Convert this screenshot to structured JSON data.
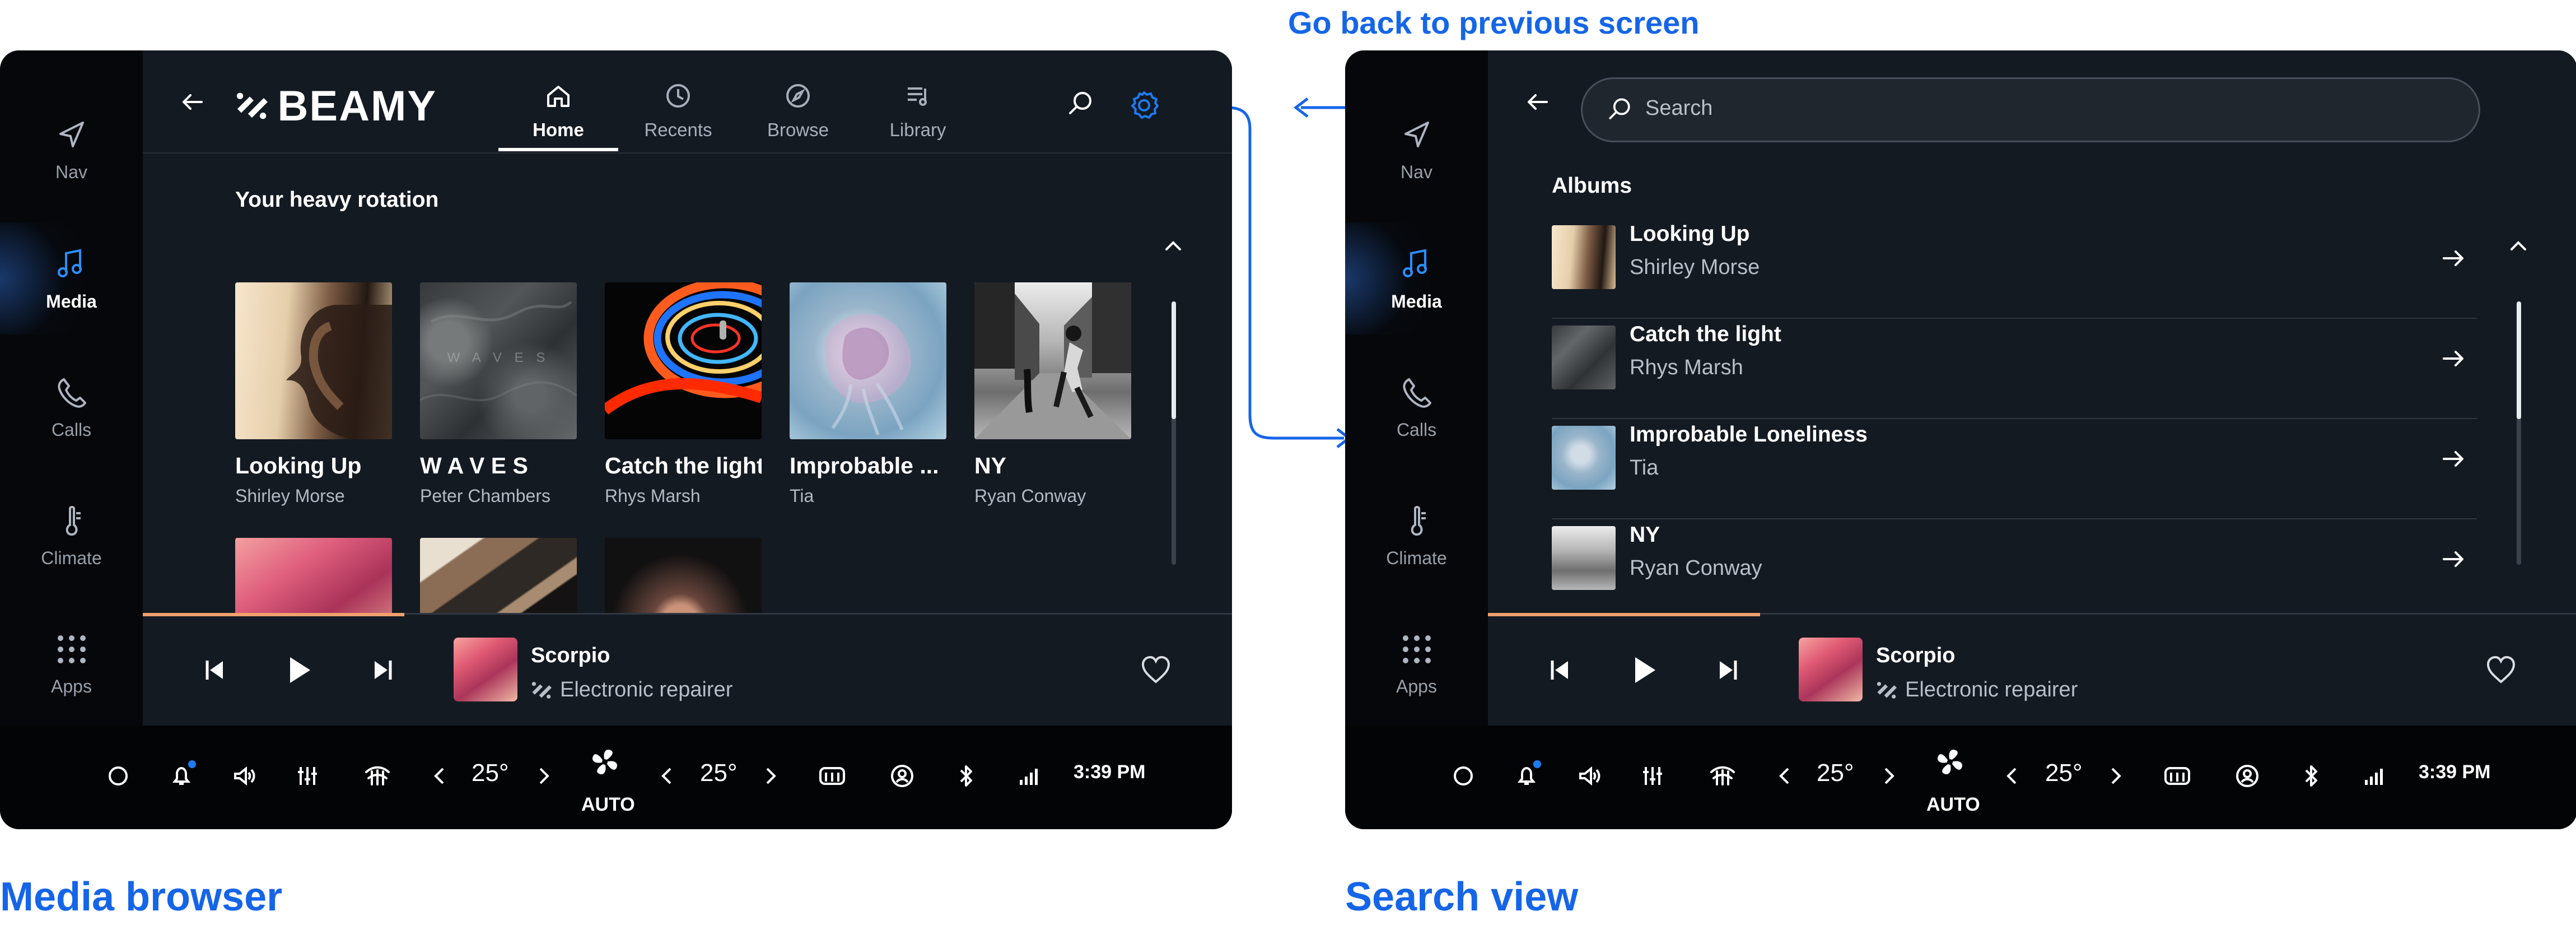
{
  "annotations": {
    "back_note": "Go back to previous screen",
    "media_browser": "Media browser",
    "search_view": "Search view"
  },
  "colors": {
    "annotation_blue": "#1565e8",
    "active_blue": "#2b8fff",
    "progress_orange": "#f1a06e"
  },
  "sidebar": {
    "items": [
      {
        "label": "Nav",
        "icon": "navigation-icon"
      },
      {
        "label": "Media",
        "icon": "music-note-icon",
        "active": true
      },
      {
        "label": "Calls",
        "icon": "phone-icon"
      },
      {
        "label": "Climate",
        "icon": "thermometer-icon"
      },
      {
        "label": "Apps",
        "icon": "grid-icon"
      }
    ]
  },
  "header": {
    "brand": "BEAMY",
    "tabs": [
      "Home",
      "Recents",
      "Browse",
      "Library"
    ],
    "active_tab": "Home"
  },
  "media_browser": {
    "section_title": "Your heavy rotation",
    "albums": [
      {
        "title": "Looking Up",
        "artist": "Shirley Morse"
      },
      {
        "title": "W A V E S",
        "artist": "Peter Chambers"
      },
      {
        "title": "Catch the light",
        "artist": "Rhys Marsh"
      },
      {
        "title": "Improbable ...",
        "artist": "Tia"
      },
      {
        "title": "NY",
        "artist": "Ryan Conway"
      }
    ]
  },
  "search_view": {
    "placeholder": "Search",
    "section_title": "Albums",
    "results": [
      {
        "title": "Looking Up",
        "artist": "Shirley Morse"
      },
      {
        "title": "Catch the light",
        "artist": "Rhys Marsh"
      },
      {
        "title": "Improbable Loneliness",
        "artist": "Tia"
      },
      {
        "title": "NY",
        "artist": "Ryan Conway"
      }
    ]
  },
  "player": {
    "title": "Scorpio",
    "artist": "Electronic repairer",
    "progress_left": 0.24,
    "progress_right": 0.25
  },
  "systembar": {
    "temp_left": "25°",
    "temp_right": "25°",
    "auto": "AUTO",
    "time": "3:39 PM"
  }
}
